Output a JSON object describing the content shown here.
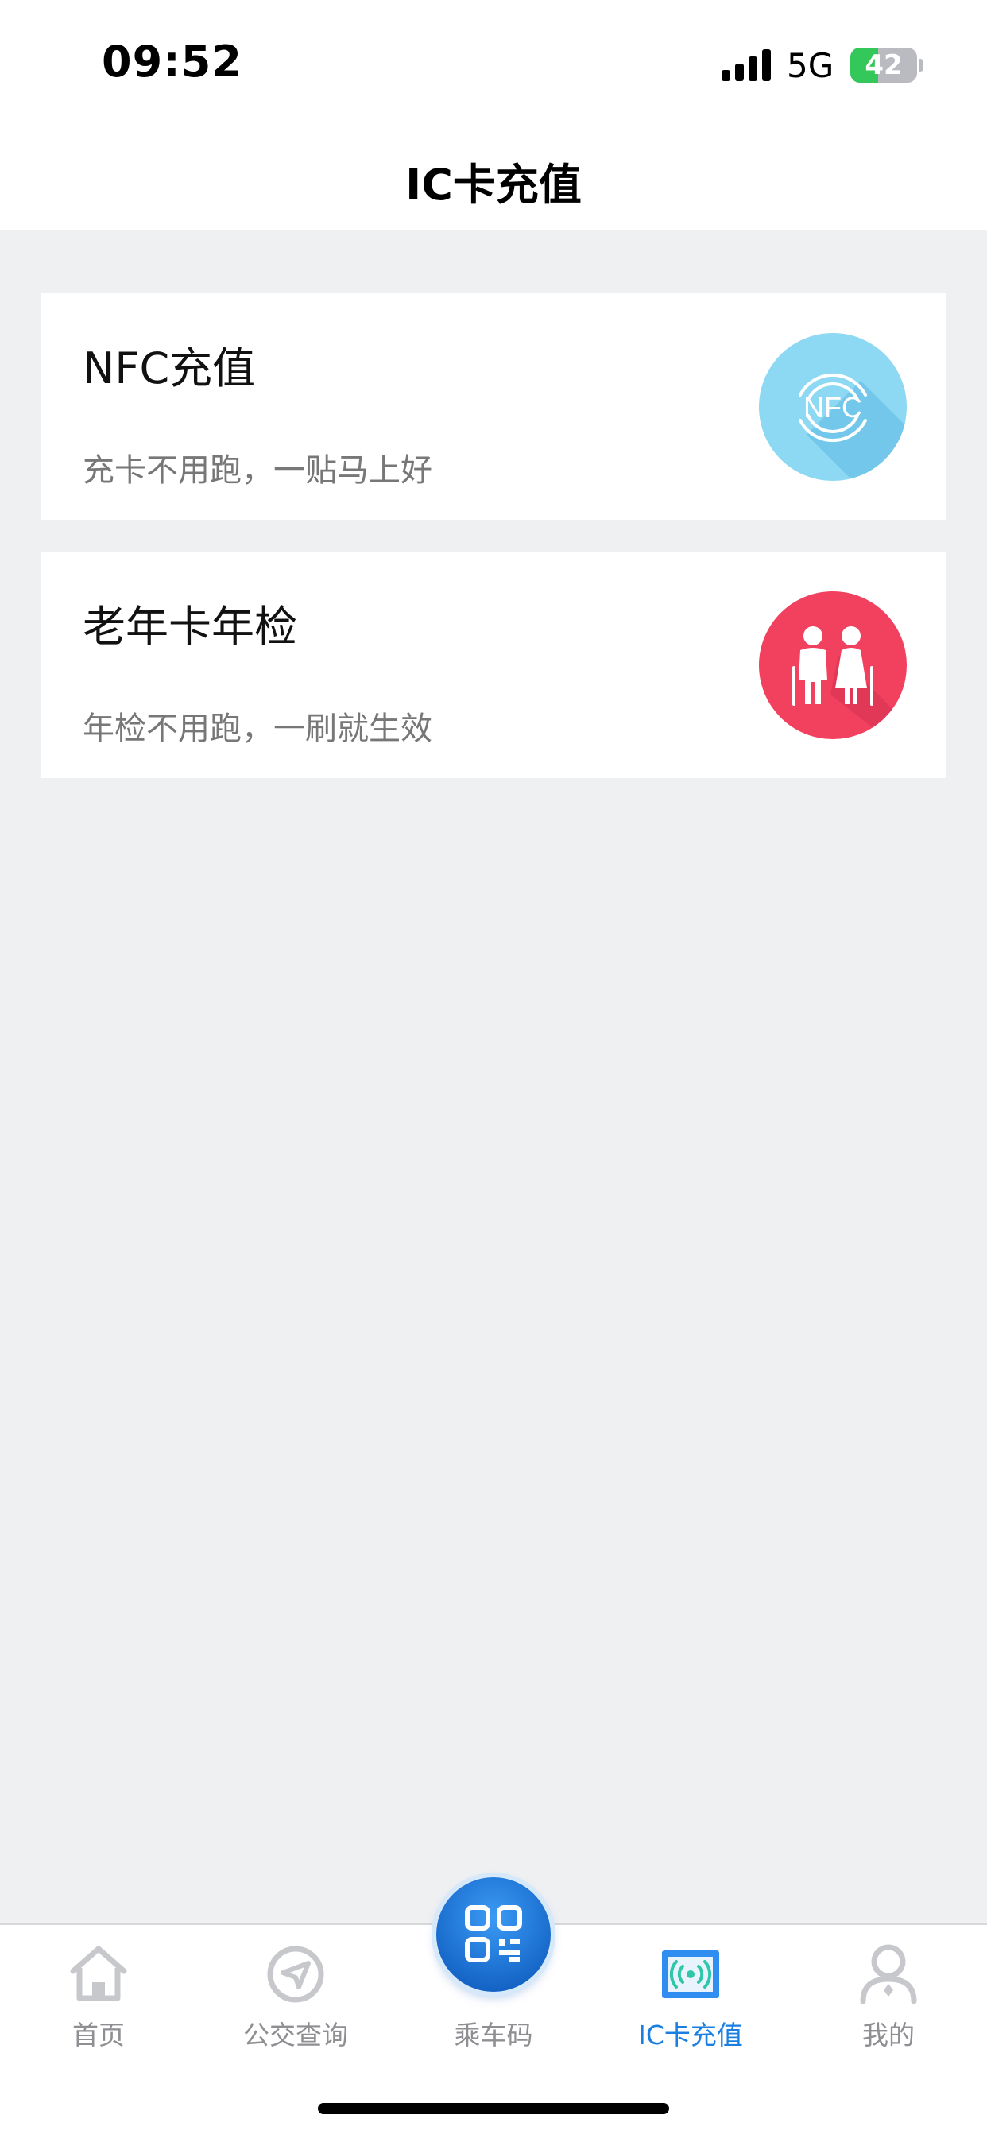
{
  "status_bar": {
    "time": "09:52",
    "network": "5G",
    "battery": "42",
    "battery_level": 0.42
  },
  "nav": {
    "title": "IC卡充值"
  },
  "cards": [
    {
      "title": "NFC充值",
      "subtitle": "充卡不用跑，一贴马上好",
      "icon": "nfc-icon",
      "icon_color": "#8dd8f2"
    },
    {
      "title": "老年卡年检",
      "subtitle": "年检不用跑，一刷就生效",
      "icon": "elderly-couple-icon",
      "icon_color": "#f2405f"
    }
  ],
  "tabs": [
    {
      "label": "首页",
      "icon": "home-icon"
    },
    {
      "label": "公交查询",
      "icon": "navigate-icon"
    },
    {
      "label": "乘车码",
      "icon": "qr-code-icon"
    },
    {
      "label": "IC卡充值",
      "icon": "nfc-card-icon",
      "active": true
    },
    {
      "label": "我的",
      "icon": "profile-icon"
    }
  ],
  "colors": {
    "accent": "#1a7fe0",
    "inactive": "#8e8e93",
    "background": "#eff0f2"
  }
}
